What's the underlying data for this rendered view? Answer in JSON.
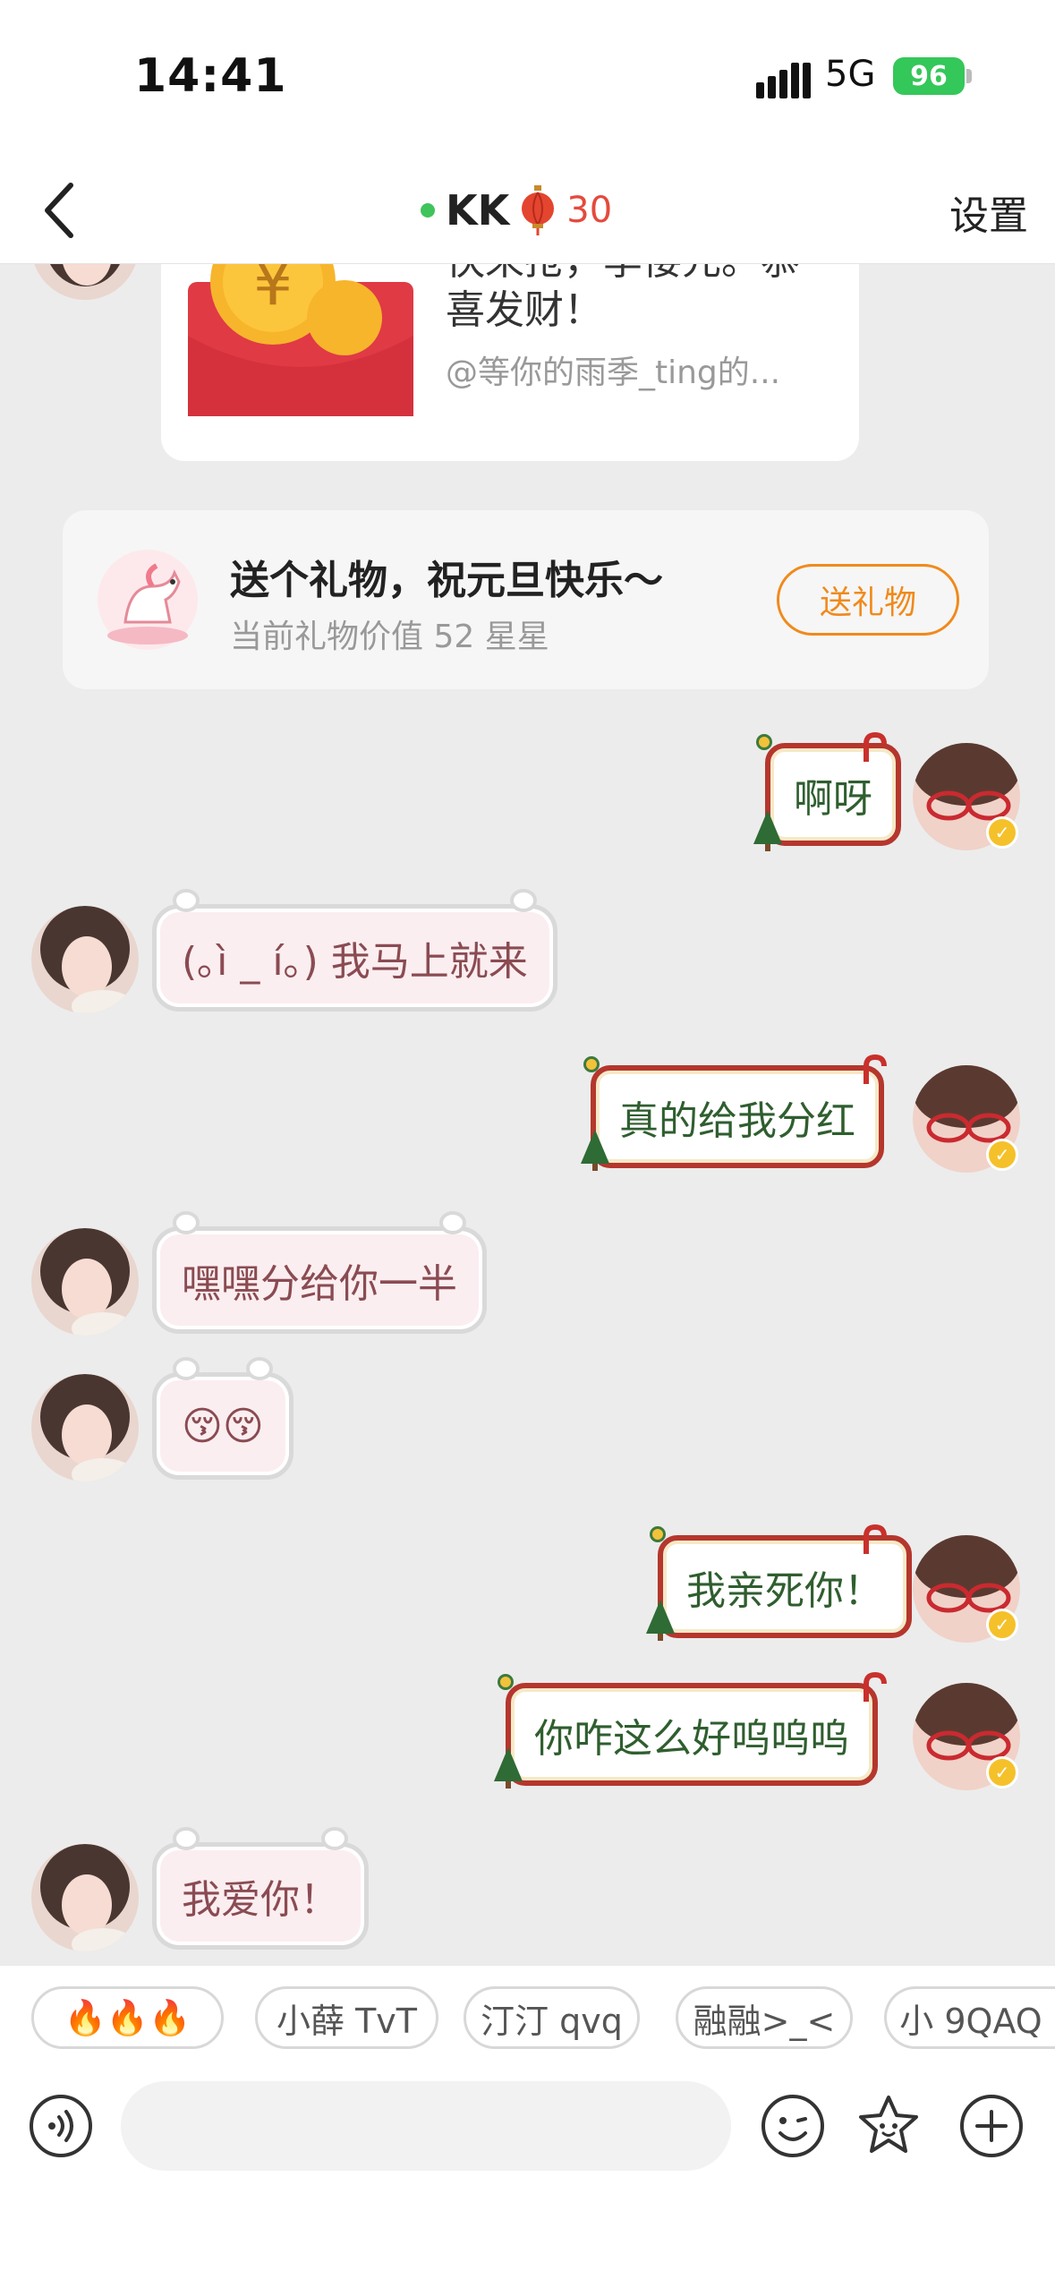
{
  "status": {
    "time": "14:41",
    "network": "5G",
    "battery": "96"
  },
  "header": {
    "title": "KK",
    "intimacy": "30",
    "settings": "设置"
  },
  "red_packet": {
    "text_line1": "快来抢，李倭元。恭",
    "text_line2": "喜发财！",
    "from": "@等你的雨季_ting的..."
  },
  "gift_card": {
    "title": "送个礼物，祝元旦快乐～",
    "subtitle": "当前礼物价值 52 星星",
    "button": "送礼物"
  },
  "messages": [
    {
      "from": "me",
      "text": "啊呀"
    },
    {
      "from": "her",
      "text": "(｡ì _ í｡) 我马上就来"
    },
    {
      "from": "me",
      "text": "真的给我分红"
    },
    {
      "from": "her",
      "text": "嘿嘿分给你一半"
    },
    {
      "from": "her",
      "text": "😚😚"
    },
    {
      "from": "me",
      "text": "我亲死你！"
    },
    {
      "from": "me",
      "text": "你咋这么好呜呜呜"
    },
    {
      "from": "her",
      "text": "我爱你！"
    }
  ],
  "quick_replies": [
    "🔥🔥🔥",
    "小薛 TvT",
    "汀汀 qvq",
    "融融>_<",
    "小 9QAQ"
  ],
  "input": {
    "placeholder": ""
  },
  "colors": {
    "accent_orange": "#f08a1c",
    "online_green": "#3fc45b",
    "intimacy_red": "#e44a3c"
  }
}
